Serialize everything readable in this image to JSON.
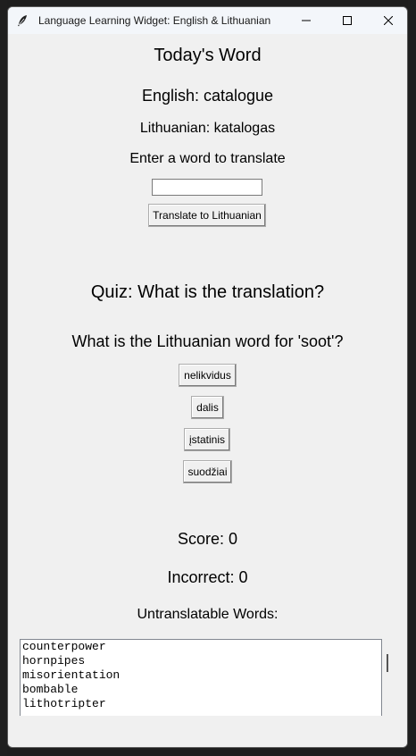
{
  "window": {
    "title": "Language Learning Widget: English & Lithuanian"
  },
  "daily": {
    "heading": "Today's Word",
    "english": "English: catalogue",
    "lithuanian": "Lithuanian: katalogas"
  },
  "translate": {
    "prompt": "Enter a word to translate",
    "input_value": "",
    "button_label": "Translate to Lithuanian"
  },
  "quiz": {
    "heading": "Quiz: What is the translation?",
    "question": "What is the Lithuanian word for 'soot'?",
    "options": [
      "nelikvidus",
      "dalis",
      "įstatinis",
      "suodžiai"
    ]
  },
  "stats": {
    "score": "Score: 0",
    "incorrect": "Incorrect: 0"
  },
  "untranslatable": {
    "heading": "Untranslatable Words:",
    "words": [
      "counterpower",
      "hornpipes",
      "misorientation",
      "bombable",
      "lithotripter"
    ]
  },
  "colors": {
    "window_bg": "#f0f0f0",
    "titlebar_bg": "#f3f6fa",
    "desktop_bg": "#1e1e1e"
  }
}
